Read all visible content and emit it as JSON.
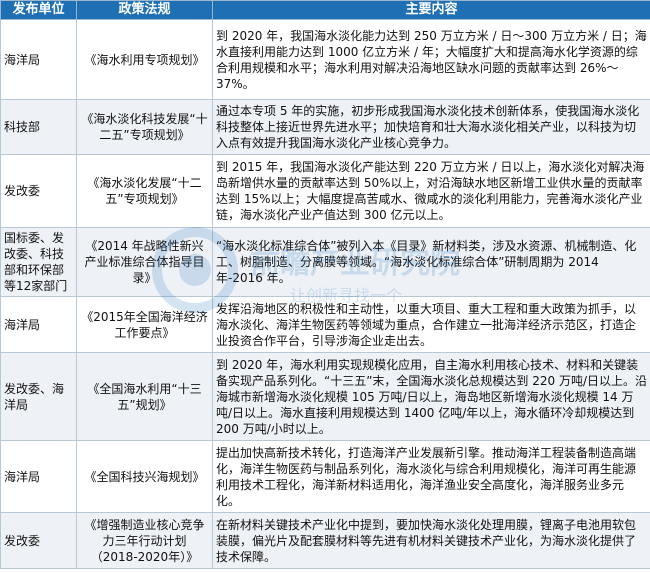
{
  "headers": [
    "发布单位",
    "政策法规",
    "主要内容"
  ],
  "rows": [
    {
      "unit": "海洋局",
      "policy": "《海水利用专项规划》",
      "content": "到 2020 年，我国海水淡化能力达到 250 万立方米 / 日～300 万立方米 / 日；海水直接利用能力达到 1000 亿立方米 / 年；大幅度扩大和提高海水化学资源的综合利用规模和水平；海水利用对解决沿海地区缺水问题的贡献率达到 26%～37%。"
    },
    {
      "unit": "科技部",
      "policy": "《海水淡化科技发展“十二五”专项规划》",
      "content": "通过本专项 5 年的实施，初步形成我国海水淡化技术创新体系，使我国海水淡化科技整体上接近世界先进水平；加快培育和壮大海水淡化相关产业，以科技为切入点有效提升我国海水淡化产业核心竞争力。"
    },
    {
      "unit": "发改委",
      "policy": "《海水淡化发展“十二五”专项规划》",
      "content": "到 2015 年，我国海水淡化产能达到 220 万立方米 / 日以上，海水淡化对解决海岛新增供水量的贡献率达到 50%以上，对沿海缺水地区新增工业供水量的贡献率达到 15%以上；大幅度提高苦咸水、微咸水的淡化利用能力，完善海水淡化产业链，海水淡化产业产值达到 300 亿元以上。"
    },
    {
      "unit": "国标委、发改委、科技部和环保部等12家部门",
      "policy": "《2014 年战略性新兴产业标准综合体指导目录》",
      "content": "“海水淡化标准综合体”被列入本《目录》新材料类，涉及水资源、机械制造、化工、树脂制造、分离膜等领域。“海水淡化标准综合体”研制周期为 2014 年-2016 年。"
    },
    {
      "unit": "海洋局",
      "policy": "《2015年全国海洋经济工作要点》",
      "content": "发挥沿海地区的积极性和主动性，以重大项目、重大工程和重大政策为抓手，以海水淡化、海洋生物医药等领域为重点，合作建立一批海洋经济示范区，打造企业投资合作平台，引导涉海企业走出去。"
    },
    {
      "unit": "发改委、海洋局",
      "policy": "《全国海水利用“十三五”规划》",
      "content": "到 2020 年，海水利用实现规模化应用，自主海水利用核心技术、材料和关键装备实现产品系列化。“十三五”末，全国海水淡化总规模达到 220 万吨/日以上。沿海城市新增海水淡化规模 105 万吨/日以上，海岛地区新增海水淡化规模 14 万吨/日以上。海水直接利用规模达到 1400 亿吨/年以上，海水循环冷却规模达到 200 万吨/小时以上。"
    },
    {
      "unit": "海洋局",
      "policy": "《全国科技兴海规划》",
      "content": "提出加快高新技术转化，打造海洋产业发展新引擎。推动海洋工程装备制造高端化，海洋生物医药与制品系列化，海水淡化与综合利用规模化，海洋可再生能源利用技术工程化，海洋新材料适用化，海洋渔业安全高度化，海洋服务业多元化。"
    },
    {
      "unit": "发改委",
      "policy": "《增强制造业核心竞争力三年行动计划（2018-2020年）》",
      "content": "在新材料关键技术产业化中提到，要加快海水淡化处理用膜，锂离子电池用软包装膜，偏光片及配套膜材料等先进有机材料关键技术产业化，为海水淡化提供了技术保障。"
    }
  ],
  "watermark": {
    "text": "前瞻产业研究院",
    "subtext": "让创新寻找一个"
  }
}
